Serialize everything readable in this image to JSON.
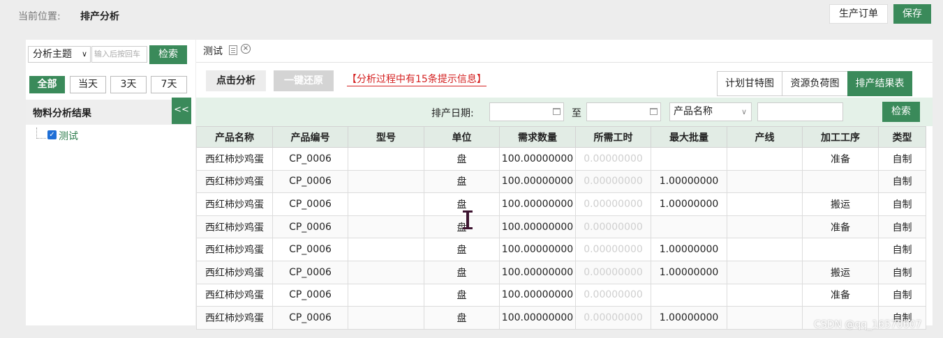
{
  "breadcrumb": {
    "label": "当前位置:",
    "page": "排产分析"
  },
  "header_actions": {
    "order_label": "生产订单",
    "save_label": "保存"
  },
  "left": {
    "topic_select": "分析主题",
    "search_placeholder": "输入后按回车",
    "search_label": "检索",
    "ranges": [
      "全部",
      "当天",
      "3天",
      "7天"
    ],
    "active_range": "全部",
    "result_title": "物料分析结果",
    "collapse_label": "<<",
    "tree": [
      {
        "label": "测试",
        "checked": true
      }
    ]
  },
  "tab": {
    "label": "测试"
  },
  "toolbar": {
    "analyze_label": "点击分析",
    "restore_label": "一键还原",
    "notice": "【分析过程中有15条提示信息】",
    "views": [
      "计划甘特图",
      "资源负荷图",
      "排产结果表"
    ],
    "active_view": "排产结果表"
  },
  "filter": {
    "date_label": "排产日期:",
    "to_label": "至",
    "field_select": "产品名称",
    "search_label": "检索"
  },
  "table": {
    "columns": [
      "产品名称",
      "产品编号",
      "型号",
      "单位",
      "需求数量",
      "所需工时",
      "最大批量",
      "产线",
      "加工工序",
      "类型"
    ],
    "rows": [
      [
        "西红柿炒鸡蛋",
        "CP_0006",
        "",
        "盘",
        "100.00000000",
        "0.00000000",
        "",
        "",
        "准备",
        "自制"
      ],
      [
        "西红柿炒鸡蛋",
        "CP_0006",
        "",
        "盘",
        "100.00000000",
        "0.00000000",
        "1.00000000",
        "",
        "",
        "自制"
      ],
      [
        "西红柿炒鸡蛋",
        "CP_0006",
        "",
        "盘",
        "100.00000000",
        "0.00000000",
        "1.00000000",
        "",
        "搬运",
        "自制"
      ],
      [
        "西红柿炒鸡蛋",
        "CP_0006",
        "",
        "盘",
        "100.00000000",
        "0.00000000",
        "",
        "",
        "准备",
        "自制"
      ],
      [
        "西红柿炒鸡蛋",
        "CP_0006",
        "",
        "盘",
        "100.00000000",
        "0.00000000",
        "1.00000000",
        "",
        "",
        "自制"
      ],
      [
        "西红柿炒鸡蛋",
        "CP_0006",
        "",
        "盘",
        "100.00000000",
        "0.00000000",
        "1.00000000",
        "",
        "搬运",
        "自制"
      ],
      [
        "西红柿炒鸡蛋",
        "CP_0006",
        "",
        "盘",
        "100.00000000",
        "0.00000000",
        "",
        "",
        "准备",
        "自制"
      ],
      [
        "西红柿炒鸡蛋",
        "CP_0006",
        "",
        "盘",
        "100.00000000",
        "0.00000000",
        "1.00000000",
        "",
        "",
        "自制"
      ]
    ]
  },
  "watermark": "CSDN @qq_16570607",
  "colors": {
    "accent": "#3a8a5a",
    "notice": "#d42020",
    "filter_bg": "#e4f1e8"
  }
}
